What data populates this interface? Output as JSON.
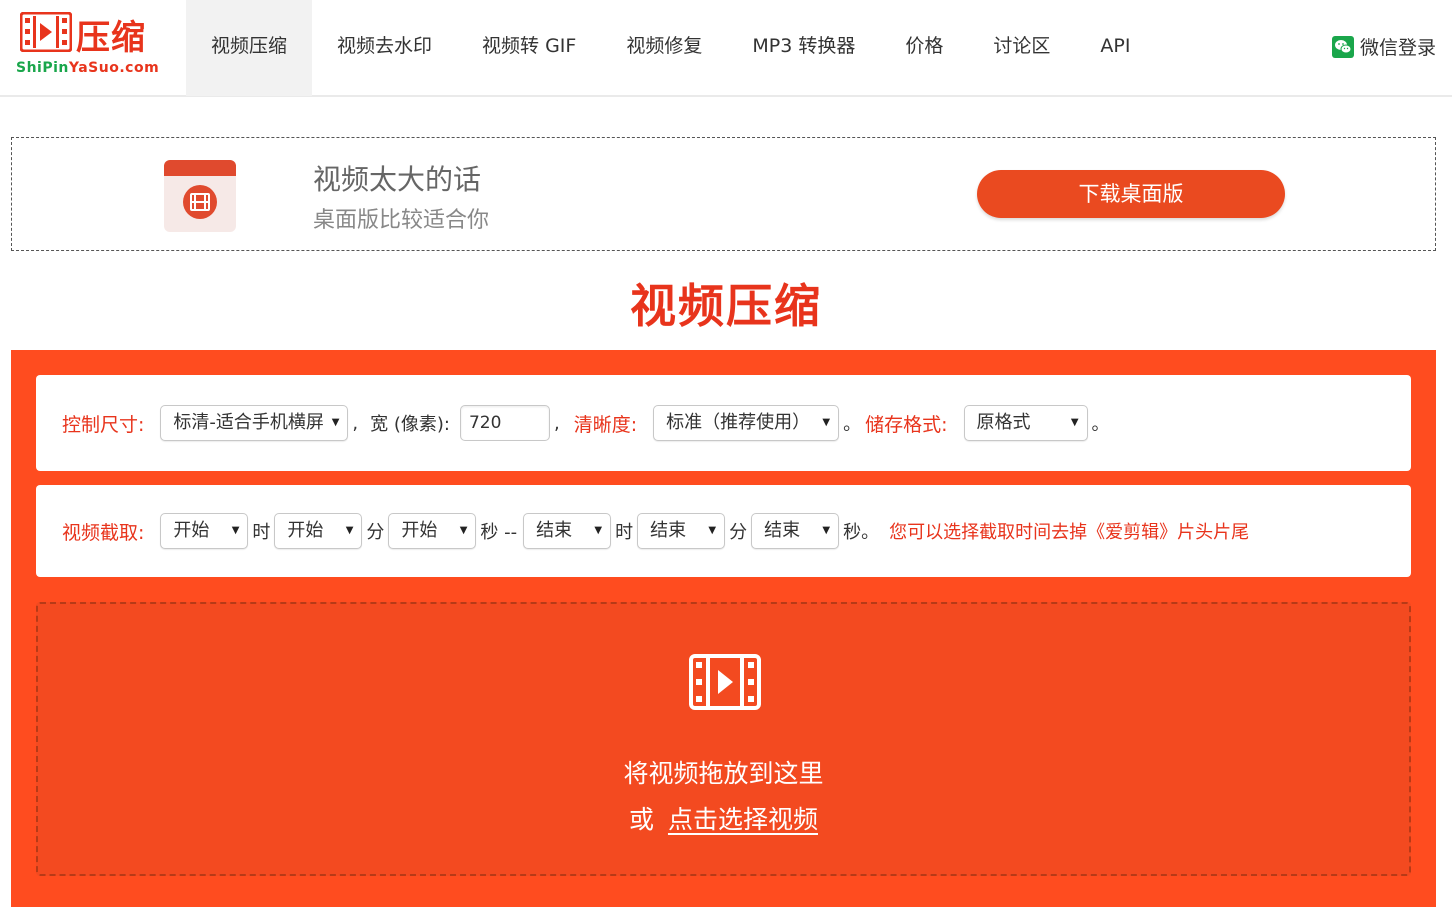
{
  "header": {
    "logo_title": "压缩",
    "logo_domain_green": "ShiPin",
    "logo_domain_red": "YaSuo.com",
    "nav": [
      {
        "label": "视频压缩",
        "active": true
      },
      {
        "label": "视频去水印"
      },
      {
        "label": "视频转 GIF"
      },
      {
        "label": "视频修复"
      },
      {
        "label": "MP3 转换器"
      },
      {
        "label": "价格"
      },
      {
        "label": "讨论区"
      },
      {
        "label": "API"
      }
    ],
    "login_label": "微信登录"
  },
  "promo": {
    "line1": "视频太大的话",
    "line2": "桌面版比较适合你",
    "button": "下载桌面版"
  },
  "page_title": "视频压缩",
  "settings": {
    "size_label": "控制尺寸:",
    "size_value": "标清-适合手机横屏",
    "comma1": ",",
    "width_label": "宽 (像素):",
    "width_value": "720",
    "comma2": ",",
    "quality_label": "清晰度:",
    "quality_value": "标准（推荐使用）",
    "period1": "。",
    "format_label": "储存格式:",
    "format_value": "原格式",
    "period2": "。"
  },
  "clip": {
    "label": "视频截取:",
    "start_hour": "开始",
    "unit_hour": "时",
    "start_min": "开始",
    "unit_min": "分",
    "start_sec": "开始",
    "unit_sec_dash": "秒 --",
    "end_hour": "结束",
    "unit_hour2": "时",
    "end_min": "结束",
    "unit_min2": "分",
    "end_sec": "结束",
    "unit_sec2": "秒。",
    "hint": "您可以选择截取时间去掉《爱剪辑》片头片尾"
  },
  "dropzone": {
    "line1": "将视频拖放到这里",
    "or": "或",
    "link": "点击选择视频"
  },
  "colors": {
    "brand_red": "#e8341c",
    "main_orange": "#ff4c1f",
    "wechat_green": "#1aa64b"
  }
}
